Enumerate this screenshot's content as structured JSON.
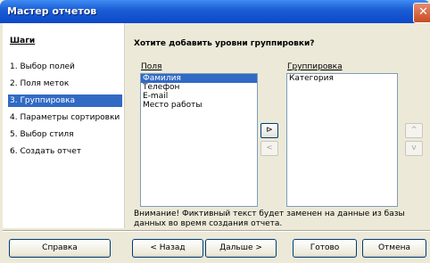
{
  "window": {
    "title": "Мастер отчетов",
    "close_label": "✕"
  },
  "steps": {
    "title": "Шаги",
    "items": [
      {
        "label": "1. Выбор полей",
        "selected": false
      },
      {
        "label": "2. Поля меток",
        "selected": false
      },
      {
        "label": "3. Группировка",
        "selected": true
      },
      {
        "label": "4. Параметры сортировки",
        "selected": false
      },
      {
        "label": "5. Выбор стиля",
        "selected": false
      },
      {
        "label": "6. Создать отчет",
        "selected": false
      }
    ]
  },
  "main": {
    "question": "Хотите добавить уровни группировки?",
    "fields_label": "Поля",
    "fields": [
      "Фамилия",
      "Телефон",
      "E-mail",
      "Место работы"
    ],
    "selected_field": "Фамилия",
    "grouping_label": "Группировка",
    "grouping": [
      "Категория"
    ],
    "add_icon": "arrow-right-icon",
    "remove_icon": "arrow-left-icon",
    "up_icon": "arrow-up-icon",
    "down_icon": "arrow-down-icon",
    "add_label": "⊳",
    "remove_label": "<",
    "up_label": "^",
    "down_label": "v",
    "notice": "Внимание! Фиктивный текст будет заменен на данные из базы данных во время создания отчета."
  },
  "buttons": {
    "help": "Справка",
    "back": "< Назад",
    "next": "Дальше >",
    "finish": "Готово",
    "cancel": "Отмена"
  }
}
